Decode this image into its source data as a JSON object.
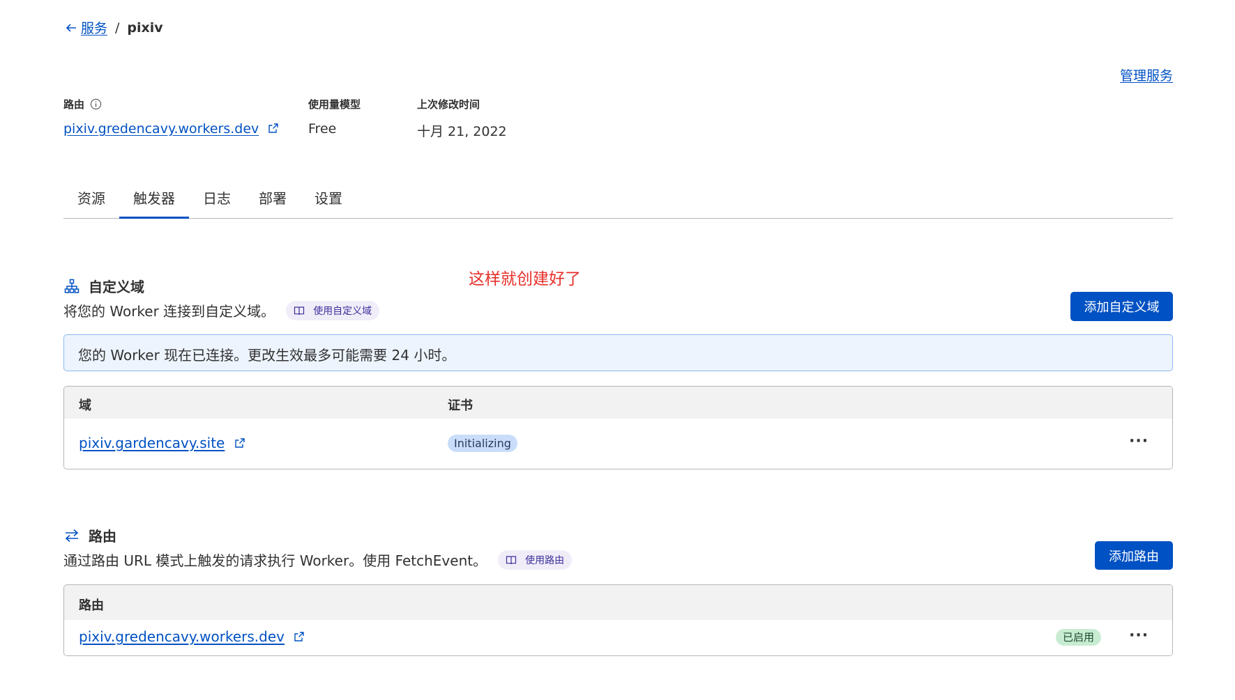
{
  "breadcrumb": {
    "back_label": "服务",
    "separator": "/",
    "current": "pixiv"
  },
  "header": {
    "manage_link": "管理服务"
  },
  "meta": {
    "route_label": "路由",
    "route_value": "pixiv.gredencavy.workers.dev",
    "usage_label": "使用量模型",
    "usage_value": "Free",
    "modified_label": "上次修改时间",
    "modified_value": "十月 21, 2022"
  },
  "tabs": [
    {
      "label": "资源",
      "active": false
    },
    {
      "label": "触发器",
      "active": true
    },
    {
      "label": "日志",
      "active": false
    },
    {
      "label": "部署",
      "active": false
    },
    {
      "label": "设置",
      "active": false
    }
  ],
  "annotation": "这样就创建好了",
  "custom_domains": {
    "title": "自定义域",
    "description": "将您的 Worker 连接到自定义域。",
    "doc_link": "使用自定义域",
    "add_button": "添加自定义域",
    "notice": "您的 Worker 现在已连接。更改生效最多可能需要 24 小时。",
    "columns": [
      "域",
      "证书"
    ],
    "rows": [
      {
        "domain": "pixiv.gardencavy.site",
        "certificate": "Initializing"
      }
    ]
  },
  "routes": {
    "title": "路由",
    "description": "通过路由 URL 模式上触发的请求执行 Worker。使用 FetchEvent。",
    "doc_link": "使用路由",
    "add_button": "添加路由",
    "columns": [
      "路由"
    ],
    "rows": [
      {
        "route": "pixiv.gredencavy.workers.dev",
        "status": "已启用"
      }
    ]
  },
  "more_menu": "···",
  "colors": {
    "accent": "#0051c3",
    "annotation": "#e8302a",
    "notice_bg": "#edf4fe",
    "enabled_badge": "#c7ecd2"
  }
}
